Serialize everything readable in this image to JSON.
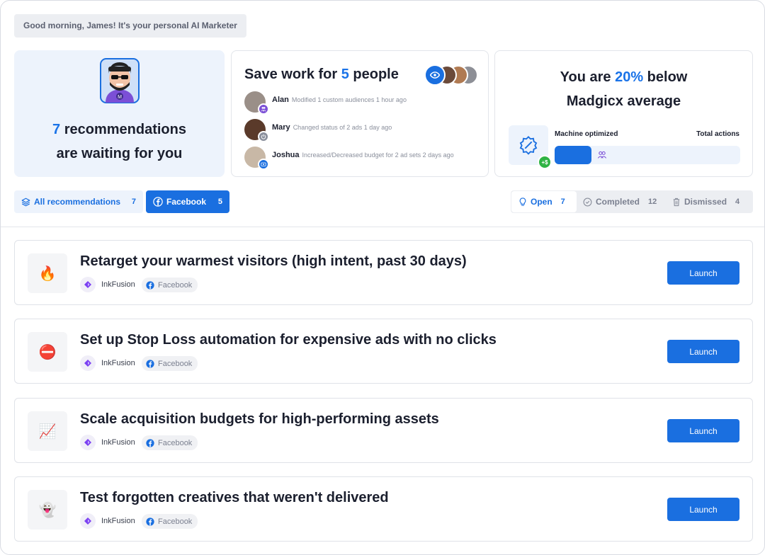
{
  "greeting": "Good morning, James! It's your personal AI Marketer",
  "recommendations_card": {
    "count": "7",
    "line1_rest": " recommendations",
    "line2": "are waiting for you"
  },
  "save_work_card": {
    "title_prefix": "Save work for ",
    "count": "5",
    "title_suffix": " people",
    "people": [
      {
        "name": "Alan",
        "action": "Modified 1 custom audiences 1 hour ago"
      },
      {
        "name": "Mary",
        "action": "Changed status of 2 ads 1 day ago"
      },
      {
        "name": "Joshua",
        "action": "Increased/Decreased budget for 2 ad sets 2 days ago"
      }
    ]
  },
  "benchmark_card": {
    "prefix": "You are ",
    "percent": "20%",
    "suffix": " below",
    "line2": "Madgicx average",
    "machine_label": "Machine optimized",
    "total_label": "Total actions",
    "plus_badge": "+$",
    "machine_fraction": 0.2
  },
  "filters": {
    "all_label": "All recommendations",
    "all_count": "7",
    "fb_label": "Facebook",
    "fb_count": "5"
  },
  "status_tabs": [
    {
      "label": "Open",
      "count": "7"
    },
    {
      "label": "Completed",
      "count": "12"
    },
    {
      "label": "Dismissed",
      "count": "4"
    }
  ],
  "recommendations": [
    {
      "emoji": "🔥",
      "title": "Retarget your warmest visitors (high intent, past 30 days)",
      "account": "InkFusion",
      "platform": "Facebook",
      "action": "Launch"
    },
    {
      "emoji": "⛔",
      "title": "Set up Stop Loss automation for expensive ads with no clicks",
      "account": "InkFusion",
      "platform": "Facebook",
      "action": "Launch"
    },
    {
      "emoji": "📈",
      "title": "Scale acquisition budgets for high-performing assets",
      "account": "InkFusion",
      "platform": "Facebook",
      "action": "Launch"
    },
    {
      "emoji": "👻",
      "title": "Test forgotten creatives that weren't delivered",
      "account": "InkFusion",
      "platform": "Facebook",
      "action": "Launch"
    }
  ],
  "colors": {
    "accent": "#1a6fe0",
    "success": "#2fb344",
    "card_tint": "#edf3fc"
  }
}
